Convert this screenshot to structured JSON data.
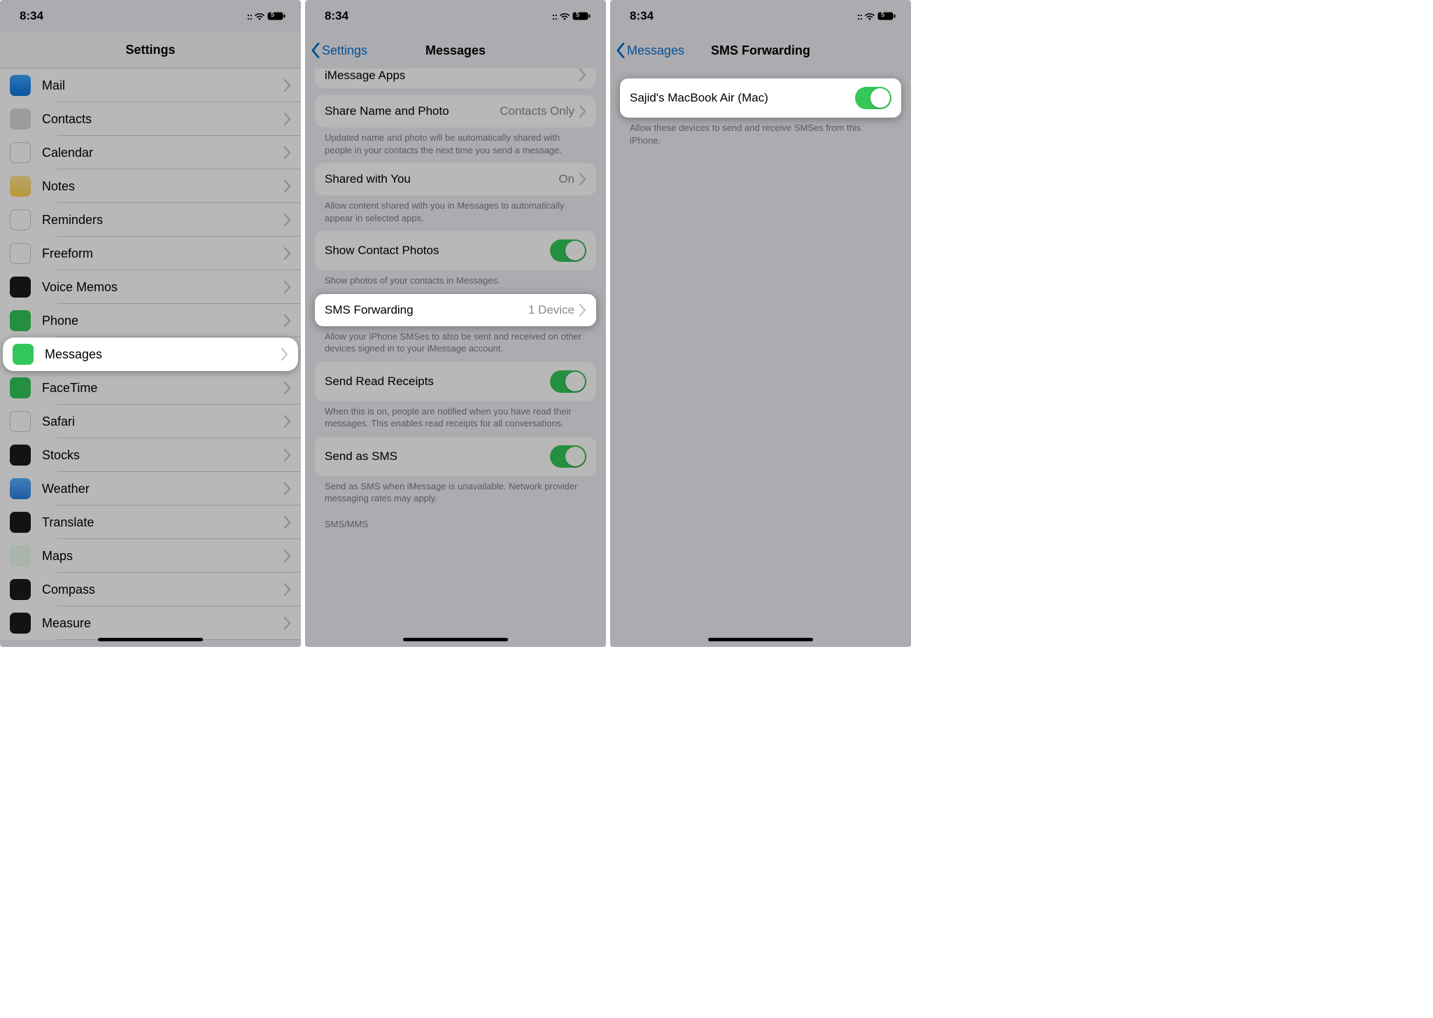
{
  "status": {
    "time": "8:34",
    "battery": "5"
  },
  "panel1": {
    "title": "Settings",
    "rows": [
      {
        "id": "mail",
        "label": "Mail",
        "icon": "ic-mail"
      },
      {
        "id": "contacts",
        "label": "Contacts",
        "icon": "ic-contacts"
      },
      {
        "id": "calendar",
        "label": "Calendar",
        "icon": "ic-calendar"
      },
      {
        "id": "notes",
        "label": "Notes",
        "icon": "ic-notes"
      },
      {
        "id": "reminders",
        "label": "Reminders",
        "icon": "ic-reminders"
      },
      {
        "id": "freeform",
        "label": "Freeform",
        "icon": "ic-freeform"
      },
      {
        "id": "voice",
        "label": "Voice Memos",
        "icon": "ic-voice"
      },
      {
        "id": "phone",
        "label": "Phone",
        "icon": "ic-phone"
      },
      {
        "id": "messages",
        "label": "Messages",
        "icon": "ic-messages",
        "highlight": true
      },
      {
        "id": "facetime",
        "label": "FaceTime",
        "icon": "ic-facetime"
      },
      {
        "id": "safari",
        "label": "Safari",
        "icon": "ic-safari"
      },
      {
        "id": "stocks",
        "label": "Stocks",
        "icon": "ic-stocks"
      },
      {
        "id": "weather",
        "label": "Weather",
        "icon": "ic-weather"
      },
      {
        "id": "translate",
        "label": "Translate",
        "icon": "ic-translate"
      },
      {
        "id": "maps",
        "label": "Maps",
        "icon": "ic-maps"
      },
      {
        "id": "compass",
        "label": "Compass",
        "icon": "ic-compass"
      },
      {
        "id": "measure",
        "label": "Measure",
        "icon": "ic-measure"
      }
    ]
  },
  "panel2": {
    "back": "Settings",
    "title": "Messages",
    "imessage_apps": "iMessage Apps",
    "share_name": {
      "label": "Share Name and Photo",
      "value": "Contacts Only"
    },
    "share_name_footer": "Updated name and photo will be automatically shared with people in your contacts the next time you send a message.",
    "shared_with_you": {
      "label": "Shared with You",
      "value": "On"
    },
    "shared_with_you_footer": "Allow content shared with you in Messages to automatically appear in selected apps.",
    "show_contact_photos": {
      "label": "Show Contact Photos"
    },
    "show_contact_photos_footer": "Show photos of your contacts in Messages.",
    "sms_forwarding": {
      "label": "SMS Forwarding",
      "value": "1 Device",
      "highlight": true
    },
    "sms_forwarding_footer": "Allow your iPhone SMSes to also be sent and received on other devices signed in to your iMessage account.",
    "send_read_receipts": {
      "label": "Send Read Receipts"
    },
    "send_read_receipts_footer": "When this is on, people are notified when you have read their messages. This enables read receipts for all conversations.",
    "send_as_sms": {
      "label": "Send as SMS"
    },
    "send_as_sms_footer": "Send as SMS when iMessage is unavailable. Network provider messaging rates may apply.",
    "sms_mms_header": "SMS/MMS"
  },
  "panel3": {
    "back": "Messages",
    "title": "SMS Forwarding",
    "device": {
      "label": "Sajid's MacBook Air (Mac)"
    },
    "footer": "Allow these devices to send and receive SMSes from this iPhone."
  }
}
